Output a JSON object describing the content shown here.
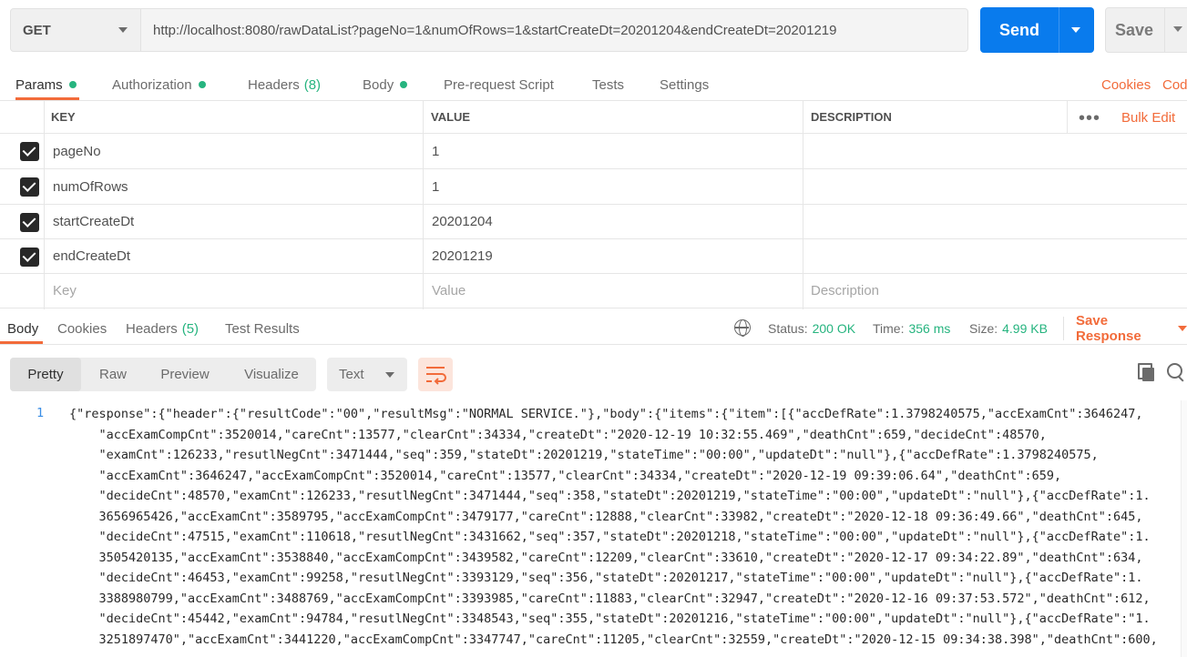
{
  "request": {
    "method": "GET",
    "url": "http://localhost:8080/rawDataList?pageNo=1&numOfRows=1&startCreateDt=20201204&endCreateDt=20201219",
    "send_label": "Send",
    "save_label": "Save"
  },
  "request_tabs": [
    {
      "label": "Params",
      "dot": true,
      "active": true
    },
    {
      "label": "Authorization",
      "dot": true
    },
    {
      "label": "Headers",
      "count": "(8)"
    },
    {
      "label": "Body",
      "dot": true
    },
    {
      "label": "Pre-request Script"
    },
    {
      "label": "Tests"
    },
    {
      "label": "Settings"
    }
  ],
  "right_links": {
    "cookies": "Cookies",
    "code": "Cod"
  },
  "params_table": {
    "headers": {
      "key": "KEY",
      "value": "VALUE",
      "description": "DESCRIPTION"
    },
    "bulk_edit": "Bulk Edit",
    "rows": [
      {
        "key": "pageNo",
        "value": "1",
        "checked": true
      },
      {
        "key": "numOfRows",
        "value": "1",
        "checked": true
      },
      {
        "key": "startCreateDt",
        "value": "20201204",
        "checked": true
      },
      {
        "key": "endCreateDt",
        "value": "20201219",
        "checked": true
      }
    ],
    "placeholders": {
      "key": "Key",
      "value": "Value",
      "description": "Description"
    }
  },
  "response_tabs": [
    {
      "label": "Body",
      "active": true
    },
    {
      "label": "Cookies"
    },
    {
      "label": "Headers",
      "count": "(5)"
    },
    {
      "label": "Test Results"
    }
  ],
  "status": {
    "status_label": "Status:",
    "status_value": "200 OK",
    "time_label": "Time:",
    "time_value": "356 ms",
    "size_label": "Size:",
    "size_value": "4.99 KB",
    "save_response": "Save Response"
  },
  "view_modes": [
    "Pretty",
    "Raw",
    "Preview",
    "Visualize"
  ],
  "format": "Text",
  "icons": {
    "wrap": "wrap-lines-icon",
    "copy": "copy-icon",
    "search": "search-icon",
    "globe": "globe-icon"
  },
  "colors": {
    "accent": "#f26b3a",
    "send": "#097bed",
    "status_green": "#26b47f"
  },
  "response_body": {
    "line_number": "1",
    "lines": [
      "{\"response\":{\"header\":{\"resultCode\":\"00\",\"resultMsg\":\"NORMAL SERVICE.\"},\"body\":{\"items\":{\"item\":[{\"accDefRate\":1.3798240575,\"accExamCnt\":3646247,",
      "    \"accExamCompCnt\":3520014,\"careCnt\":13577,\"clearCnt\":34334,\"createDt\":\"2020-12-19 10:32:55.469\",\"deathCnt\":659,\"decideCnt\":48570,",
      "    \"examCnt\":126233,\"resutlNegCnt\":3471444,\"seq\":359,\"stateDt\":20201219,\"stateTime\":\"00:00\",\"updateDt\":\"null\"},{\"accDefRate\":1.3798240575,",
      "    \"accExamCnt\":3646247,\"accExamCompCnt\":3520014,\"careCnt\":13577,\"clearCnt\":34334,\"createDt\":\"2020-12-19 09:39:06.64\",\"deathCnt\":659,",
      "    \"decideCnt\":48570,\"examCnt\":126233,\"resutlNegCnt\":3471444,\"seq\":358,\"stateDt\":20201219,\"stateTime\":\"00:00\",\"updateDt\":\"null\"},{\"accDefRate\":1.",
      "    3656965426,\"accExamCnt\":3589795,\"accExamCompCnt\":3479177,\"careCnt\":12888,\"clearCnt\":33982,\"createDt\":\"2020-12-18 09:36:49.66\",\"deathCnt\":645,",
      "    \"decideCnt\":47515,\"examCnt\":110618,\"resutlNegCnt\":3431662,\"seq\":357,\"stateDt\":20201218,\"stateTime\":\"00:00\",\"updateDt\":\"null\"},{\"accDefRate\":1.",
      "    3505420135,\"accExamCnt\":3538840,\"accExamCompCnt\":3439582,\"careCnt\":12209,\"clearCnt\":33610,\"createDt\":\"2020-12-17 09:34:22.89\",\"deathCnt\":634,",
      "    \"decideCnt\":46453,\"examCnt\":99258,\"resutlNegCnt\":3393129,\"seq\":356,\"stateDt\":20201217,\"stateTime\":\"00:00\",\"updateDt\":\"null\"},{\"accDefRate\":1.",
      "    3388980799,\"accExamCnt\":3488769,\"accExamCompCnt\":3393985,\"careCnt\":11883,\"clearCnt\":32947,\"createDt\":\"2020-12-16 09:37:53.572\",\"deathCnt\":612,",
      "    \"decideCnt\":45442,\"examCnt\":94784,\"resutlNegCnt\":3348543,\"seq\":355,\"stateDt\":20201216,\"stateTime\":\"00:00\",\"updateDt\":\"null\"},{\"accDefRate\":\"1.",
      "    3251897470\",\"accExamCnt\":3441220,\"accExamCompCnt\":3347747,\"careCnt\":11205,\"clearCnt\":32559,\"createDt\":\"2020-12-15 09:34:38.398\",\"deathCnt\":600,"
    ]
  }
}
